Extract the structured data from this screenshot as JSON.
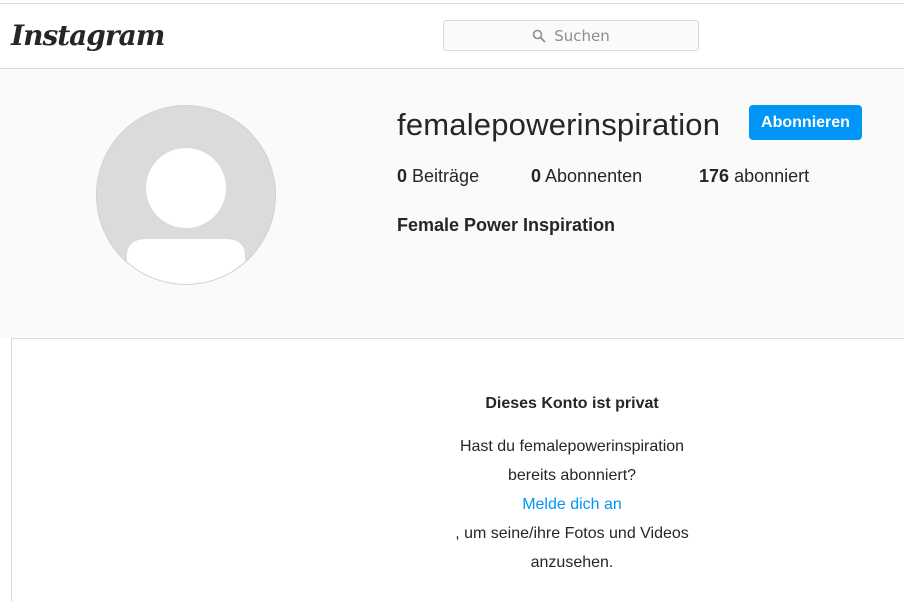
{
  "header": {
    "logo_text": "Instagram",
    "search_placeholder": "Suchen"
  },
  "profile": {
    "username": "femalepowerinspiration",
    "follow_label": "Abonnieren",
    "stats": {
      "posts_count": "0",
      "posts_label": "Beiträge",
      "followers_count": "0",
      "followers_label": "Abonnenten",
      "following_count": "176",
      "following_label": "abonniert"
    },
    "full_name": "Female Power Inspiration"
  },
  "private_notice": {
    "title": "Dieses Konto ist privat",
    "line1": "Hast du femalepowerinspiration",
    "line2": "bereits abonniert?",
    "login_link": "Melde dich an",
    "line3": ", um seine/ihre Fotos und Videos",
    "line4": "anzusehen."
  },
  "colors": {
    "accent": "#0095f6",
    "text": "#262626",
    "border": "#dbdbdb",
    "background": "#fafafa"
  },
  "icons": {
    "search": "search-icon",
    "avatar": "default-avatar-icon"
  }
}
